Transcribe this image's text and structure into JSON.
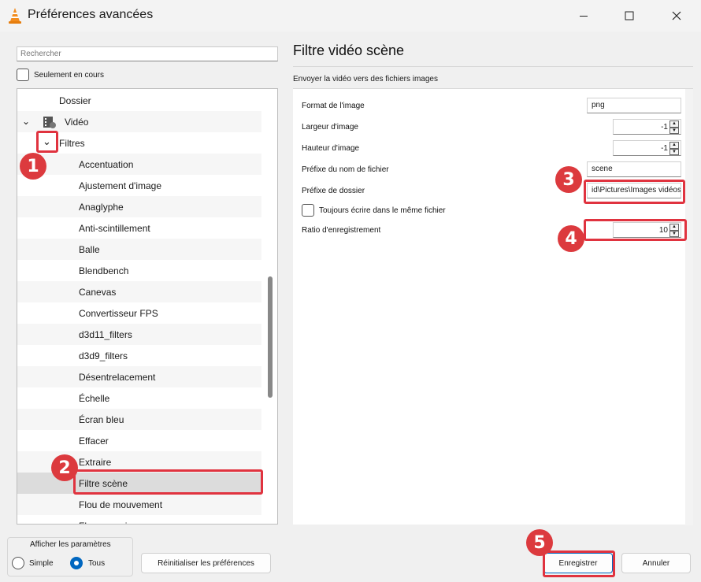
{
  "window": {
    "title": "Préférences avancées",
    "minimize_icon": "minimize-icon",
    "maximize_icon": "maximize-icon",
    "close_icon": "close-icon"
  },
  "left": {
    "search_placeholder": "Rechercher",
    "only_current_label": "Seulement en cours",
    "only_current_checked": false,
    "tree": {
      "dossier": "Dossier",
      "video": "Vidéo",
      "filtres": "Filtres",
      "items": [
        "Accentuation",
        "Ajustement d'image",
        "Anaglyphe",
        "Anti-scintillement",
        "Balle",
        "Blendbench",
        "Canevas",
        "Convertisseur FPS",
        "d3d11_filters",
        "d3d9_filters",
        "Désentrelacement",
        "Échelle",
        "Écran bleu",
        "Effacer",
        "Extraire",
        "Filtre scène",
        "Flou de mouvement",
        "Flou gaussien"
      ],
      "selected_index": 15
    }
  },
  "right": {
    "title": "Filtre vidéo scène",
    "description": "Envoyer la vidéo vers des fichiers images",
    "fields": {
      "format_label": "Format de l'image",
      "format_value": "png",
      "width_label": "Largeur d'image",
      "width_value": "-1",
      "height_label": "Hauteur d'image",
      "height_value": "-1",
      "prefix_label": "Préfixe du nom de fichier",
      "prefix_value": "scene",
      "folder_label": "Préfixe de dossier",
      "folder_value": "id\\Pictures\\Images vidéos",
      "always_label": "Toujours écrire dans le même fichier",
      "always_checked": false,
      "ratio_label": "Ratio d'enregistrement",
      "ratio_value": "10"
    }
  },
  "bottom": {
    "show_title": "Afficher les paramètres",
    "simple_label": "Simple",
    "all_label": "Tous",
    "selected": "Tous",
    "reset_label": "Réinitialiser les préférences",
    "save_label": "Enregistrer",
    "cancel_label": "Annuler"
  },
  "annotations": {
    "n1": "1",
    "n2": "2",
    "n3": "3",
    "n4": "4",
    "n5": "5",
    "color": "#dc3a3e"
  }
}
